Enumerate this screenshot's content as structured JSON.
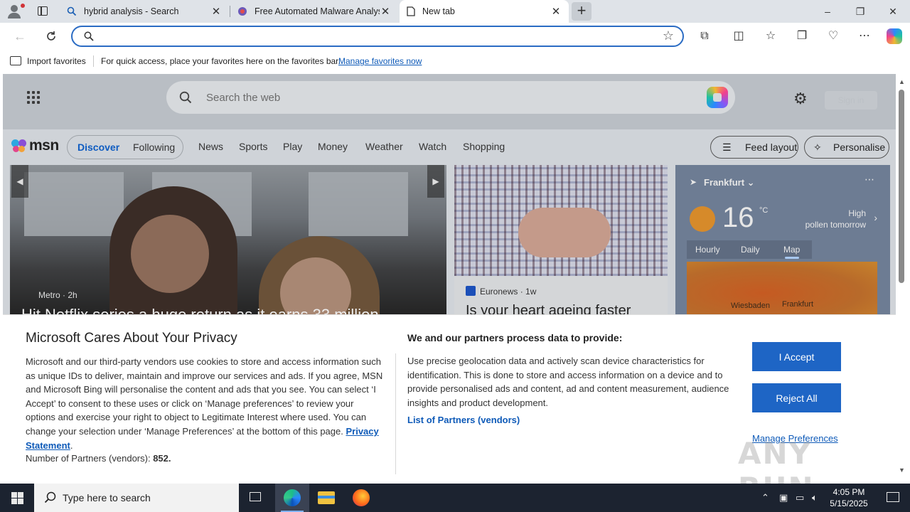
{
  "tabs": [
    {
      "title": "hybrid analysis - Search",
      "icon": "search-icon"
    },
    {
      "title": "Free Automated Malware Analysis",
      "icon": "site-icon"
    },
    {
      "title": "New tab",
      "icon": "page-icon",
      "active": true
    }
  ],
  "window_controls": {
    "minimize": "–",
    "maximize": "❐",
    "close": "✕"
  },
  "address_bar": {
    "value": "",
    "placeholder": ""
  },
  "favorites_bar": {
    "import_label": "Import favorites",
    "hint": "For quick access, place your favorites here on the favorites bar.",
    "manage_link": "Manage favorites now"
  },
  "newtab": {
    "search_placeholder": "Search the web",
    "signin_label": "Sign in",
    "logo_text": "msn",
    "pill_tabs": [
      "Discover",
      "Following"
    ],
    "nav_links": [
      "News",
      "Sports",
      "Play",
      "Money",
      "Weather",
      "Watch",
      "Shopping"
    ],
    "feed_layout_label": "Feed layout",
    "personalise_label": "Personalise"
  },
  "cards": {
    "main": {
      "source": "Metro",
      "age": "2h",
      "headline": "Hit Netflix series a huge return as it earns 33 million"
    },
    "second": {
      "source": "Euronews",
      "age": "1w",
      "headline": "Is your heart ageing faster"
    },
    "weather": {
      "location": "Frankfurt",
      "temperature": "16",
      "unit": "°C",
      "pollen_level": "High",
      "pollen_when": "pollen tomorrow",
      "tabs": [
        "Hourly",
        "Daily",
        "Map"
      ],
      "active_tab": "Map",
      "map_labels": [
        "Wiesbaden",
        "Frankfurt"
      ]
    }
  },
  "privacy": {
    "title": "Microsoft Cares About Your Privacy",
    "body": "Microsoft and our third-party vendors use cookies to store and access information such as unique IDs to deliver, maintain and improve our services and ads. If you agree, MSN and Microsoft Bing will personalise the content and ads that you see. You can select ‘I Accept’ to consent to these uses or click on ‘Manage preferences’ to review your options and exercise your right to object to Legitimate Interest where used.  You can change your selection under ‘Manage Preferences’ at the bottom of this page.",
    "privacy_link": "Privacy Statement",
    "partners_label": "Number of Partners (vendors):",
    "partners_count": "852.",
    "right_title": "We and our partners process data to provide:",
    "right_body": "Use precise geolocation data and actively scan device characteristics for identification. This is done to store and access information on a device and to provide personalised ads and content, ad and content measurement, audience insights and product development.",
    "vendors_link": "List of Partners (vendors)",
    "accept_label": "I Accept",
    "reject_label": "Reject All",
    "manage_label": "Manage Preferences"
  },
  "watermark": "ANY RUN",
  "taskbar": {
    "search_placeholder": "Type here to search",
    "time": "4:05 PM",
    "date": "5/15/2025"
  },
  "colors": {
    "accent": "#1e65c5",
    "link": "#0e5ab8",
    "taskbar": "#1c2330"
  }
}
